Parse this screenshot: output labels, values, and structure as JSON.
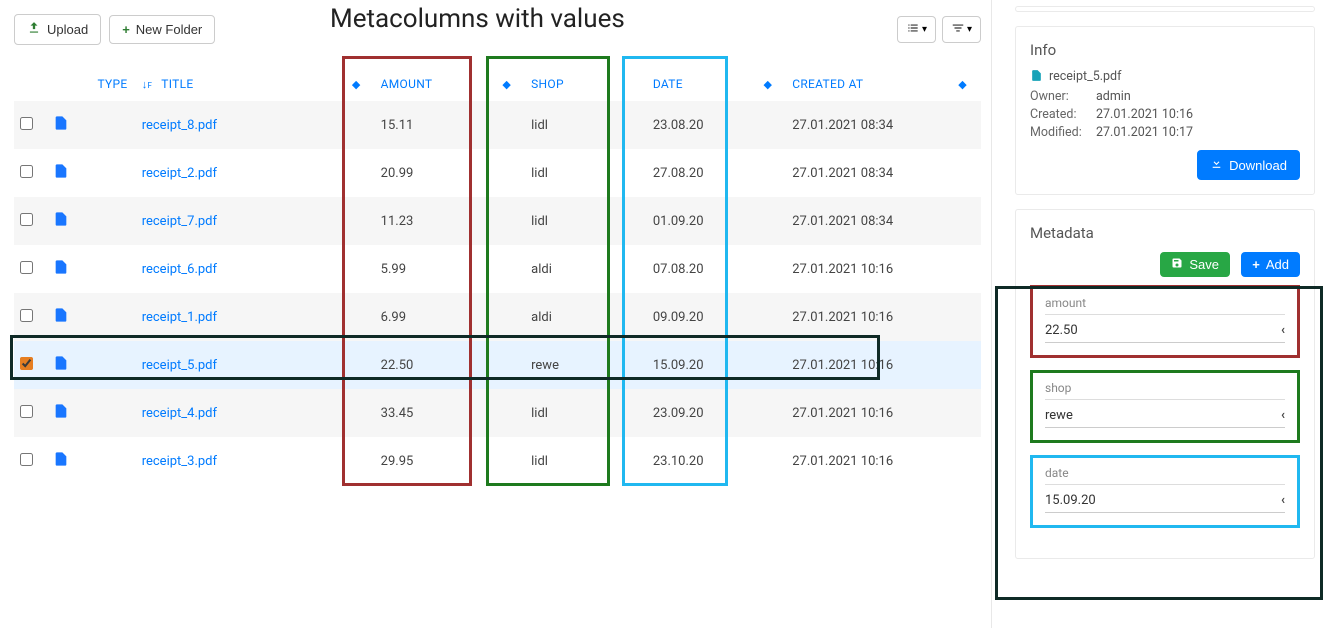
{
  "overlay_title": "Metacolumns with values",
  "toolbar": {
    "upload_label": "Upload",
    "new_folder_label": "New Folder"
  },
  "columns": {
    "type": "TYPE",
    "title": "TITLE",
    "amount": "AMOUNT",
    "shop": "SHOP",
    "date": "DATE",
    "created_at": "CREATED AT"
  },
  "rows": [
    {
      "title": "receipt_8.pdf",
      "amount": "15.11",
      "shop": "lidl",
      "date": "23.08.20",
      "created_at": "27.01.2021 08:34",
      "selected": false
    },
    {
      "title": "receipt_2.pdf",
      "amount": "20.99",
      "shop": "lidl",
      "date": "27.08.20",
      "created_at": "27.01.2021 08:34",
      "selected": false
    },
    {
      "title": "receipt_7.pdf",
      "amount": "11.23",
      "shop": "lidl",
      "date": "01.09.20",
      "created_at": "27.01.2021 08:34",
      "selected": false
    },
    {
      "title": "receipt_6.pdf",
      "amount": "5.99",
      "shop": "aldi",
      "date": "07.08.20",
      "created_at": "27.01.2021 10:16",
      "selected": false
    },
    {
      "title": "receipt_1.pdf",
      "amount": "6.99",
      "shop": "aldi",
      "date": "09.09.20",
      "created_at": "27.01.2021 10:16",
      "selected": false
    },
    {
      "title": "receipt_5.pdf",
      "amount": "22.50",
      "shop": "rewe",
      "date": "15.09.20",
      "created_at": "27.01.2021 10:16",
      "selected": true
    },
    {
      "title": "receipt_4.pdf",
      "amount": "33.45",
      "shop": "lidl",
      "date": "23.09.20",
      "created_at": "27.01.2021 10:16",
      "selected": false
    },
    {
      "title": "receipt_3.pdf",
      "amount": "29.95",
      "shop": "lidl",
      "date": "23.10.20",
      "created_at": "27.01.2021 10:16",
      "selected": false
    }
  ],
  "info": {
    "heading": "Info",
    "file_name": "receipt_5.pdf",
    "owner_label": "Owner:",
    "owner_value": "admin",
    "created_label": "Created:",
    "created_value": "27.01.2021 10:16",
    "modified_label": "Modified:",
    "modified_value": "27.01.2021 10:17",
    "download_label": "Download"
  },
  "metadata": {
    "heading": "Metadata",
    "save_label": "Save",
    "add_label": "Add",
    "fields": {
      "amount": {
        "label": "amount",
        "value": "22.50"
      },
      "shop": {
        "label": "shop",
        "value": "rewe"
      },
      "date": {
        "label": "date",
        "value": "15.09.20"
      }
    }
  },
  "colors": {
    "red": "#a03030",
    "green": "#1e7a1e",
    "cyan": "#20b8f0",
    "dark": "#0f2a26"
  }
}
